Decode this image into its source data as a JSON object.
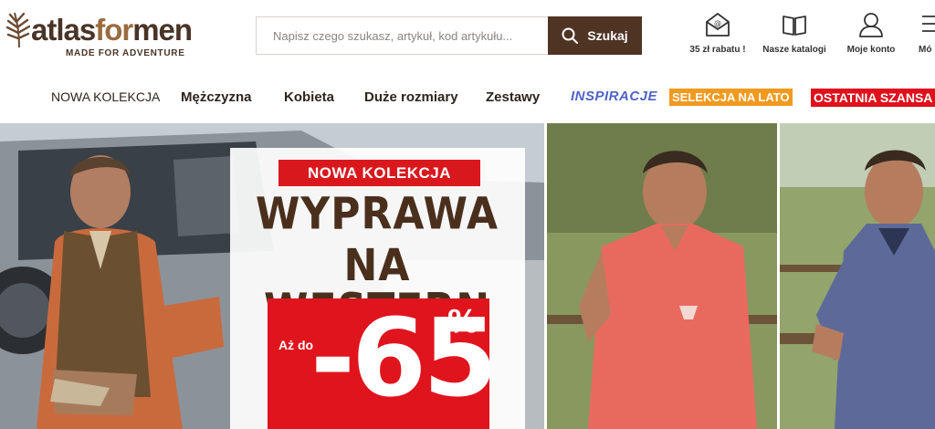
{
  "brand": {
    "name_part1": "atlas",
    "name_part2": "for",
    "name_part3": "men",
    "tagline": "MADE FOR ADVENTURE"
  },
  "search": {
    "placeholder": "Napisz czego szukasz, artykuł, kod artykułu...",
    "button_label": "Szukaj"
  },
  "tools": [
    {
      "label": "35 zł rabatu !",
      "icon": "mail-at-icon"
    },
    {
      "label": "Nasze katalogi",
      "icon": "book-icon"
    },
    {
      "label": "Moje konto",
      "icon": "user-icon"
    },
    {
      "label": "Mó",
      "icon": "list-icon"
    }
  ],
  "nav": {
    "new": "NOWA KOLEKCJA",
    "men": "Mężczyzna",
    "women": "Kobieta",
    "plus": "Duże rozmiary",
    "sets": "Zestawy",
    "inspiration": "INSPIRACJE",
    "summer": "SELEKCJA NA LATO",
    "last_chance": "OSTATNIA SZANSA"
  },
  "colors": {
    "brand_brown": "#4f3424",
    "promo_red": "#e0141d",
    "summer_orange": "#f29a1f",
    "inspiration_blue": "#4e63c9"
  },
  "hero": {
    "tag": "NOWA KOLEKCJA",
    "title_line1": "WYPRAWA",
    "title_line2": "NA WESTERN",
    "discount_prefix": "Aż do",
    "discount_value": "-65",
    "discount_unit": "%"
  }
}
